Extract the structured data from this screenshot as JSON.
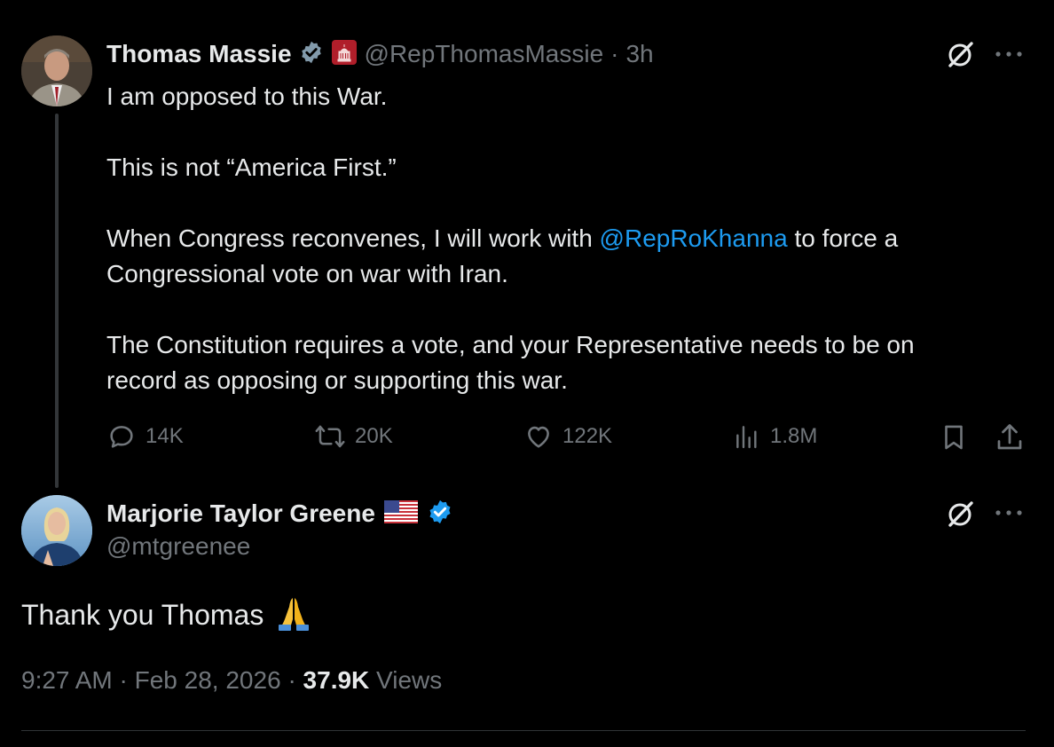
{
  "tweet1": {
    "author_name": "Thomas Massie",
    "handle": "@RepThomasMassie",
    "separator": "·",
    "time": "3h",
    "lines": {
      "l1": "I am opposed to this War.",
      "l2": "This is not “America First.”",
      "l3_pre": "When Congress reconvenes, I will work with ",
      "l3_mention": "@RepRoKhanna",
      "l3_post": " to force a",
      "l4": "Congressional vote on war with Iran.",
      "l5": "The Constitution requires a vote, and your Representative needs to be on",
      "l6": "record as opposing or supporting this war."
    },
    "stats": {
      "replies": "14K",
      "reposts": "20K",
      "likes": "122K",
      "views": "1.8M"
    }
  },
  "tweet2": {
    "author_name": "Marjorie Taylor Greene",
    "handle": "@mtgreenee",
    "text": "Thank you Thomas",
    "time": "9:27 AM",
    "sep1": "·",
    "date": "Feb 28, 2026",
    "sep2": "·",
    "views_count": "37.9K",
    "views_label": "Views"
  },
  "colors": {
    "background": "#000000",
    "text": "#e7e9ea",
    "muted": "#71767b",
    "accent": "#1d9bf0"
  },
  "icons": [
    "verified-badge-icon",
    "capitol-flag-icon",
    "grok-icon",
    "more-icon",
    "reply-icon",
    "repost-icon",
    "like-icon",
    "views-icon",
    "bookmark-icon",
    "share-icon",
    "us-flag-icon",
    "folded-hands-emoji"
  ]
}
